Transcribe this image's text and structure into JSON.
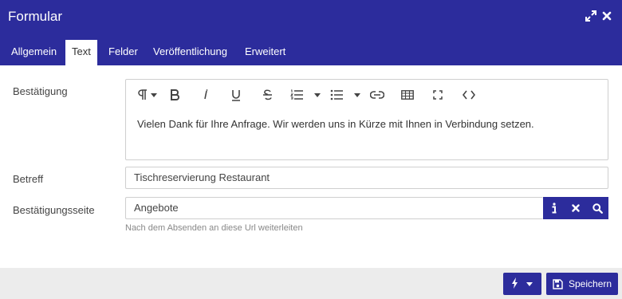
{
  "window": {
    "title": "Formular",
    "icons": [
      "expand-icon",
      "close-icon"
    ]
  },
  "tabs": [
    {
      "label": "Allgemein",
      "active": false
    },
    {
      "label": "Text",
      "active": true
    },
    {
      "label": "Felder",
      "active": false
    },
    {
      "label": "Veröffentlichung",
      "active": false
    },
    {
      "label": "Erweitert",
      "active": false
    }
  ],
  "form": {
    "confirmation": {
      "label": "Bestätigung",
      "text": "Vielen Dank für Ihre Anfrage. Wir werden uns in Kürze mit Ihnen in Verbindung setzen.",
      "toolbar": [
        "paragraph-icon",
        "bold-icon",
        "italic-icon",
        "underline-icon",
        "strikethrough-icon",
        "ordered-list-icon",
        "unordered-list-icon",
        "link-icon",
        "table-icon",
        "fullscreen-icon",
        "code-icon"
      ]
    },
    "subject": {
      "label": "Betreff",
      "value": "Tischreservierung Restaurant"
    },
    "confirmation_page": {
      "label": "Bestätigungsseite",
      "value": "Angebote",
      "hint": "Nach dem Absenden an diese Url weiterleiten",
      "addons": [
        "info-icon",
        "clear-icon",
        "search-icon"
      ]
    }
  },
  "footer": {
    "save_label": "Speichern"
  },
  "colors": {
    "primary": "#2c2c9c",
    "footer_bg": "#ececec",
    "border": "#cfcfcf"
  }
}
